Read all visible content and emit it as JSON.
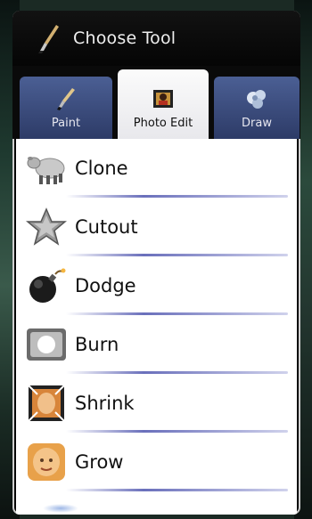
{
  "dialog": {
    "title": "Choose Tool",
    "title_icon": "paintbrush-icon"
  },
  "tabs": [
    {
      "label": "Paint",
      "icon": "brush-icon",
      "selected": false
    },
    {
      "label": "Photo Edit",
      "icon": "photo-icon",
      "selected": true
    },
    {
      "label": "Draw",
      "icon": "draw-icon",
      "selected": false
    }
  ],
  "tools": [
    {
      "label": "Clone",
      "icon": "sheep-icon"
    },
    {
      "label": "Cutout",
      "icon": "star-icon"
    },
    {
      "label": "Dodge",
      "icon": "bomb-icon"
    },
    {
      "label": "Burn",
      "icon": "burn-frame-icon"
    },
    {
      "label": "Shrink",
      "icon": "shrink-photo-icon"
    },
    {
      "label": "Grow",
      "icon": "grow-photo-icon"
    }
  ],
  "colors": {
    "tab_inactive": "#2d3b67",
    "tab_active": "#ffffff",
    "separator": "#5a60b4"
  }
}
